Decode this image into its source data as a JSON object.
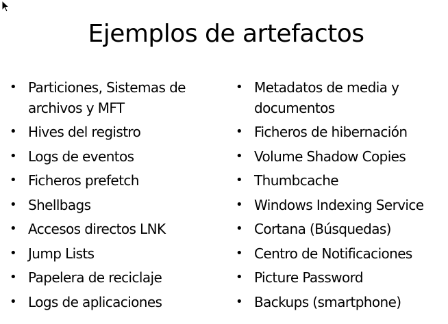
{
  "slide": {
    "title": "Ejemplos de artefactos",
    "bullet_glyph": "•",
    "left_items": [
      "Particiones, Sistemas de archivos y MFT",
      "Hives del registro",
      "Logs de eventos",
      "Ficheros prefetch",
      "Shellbags",
      "Accesos directos LNK",
      "Jump Lists",
      "Papelera de reciclaje",
      "Logs de aplicaciones"
    ],
    "right_items": [
      "Metadatos de media y documentos",
      "Ficheros de hibernación",
      "Volume Shadow Copies",
      "Thumbcache",
      "Windows Indexing Service",
      "Cortana (Búsquedas)",
      "Centro de Notificaciones",
      "Picture Password",
      "Backups (smartphone)"
    ]
  },
  "icons": {
    "cursor": "mouse-pointer-icon"
  }
}
